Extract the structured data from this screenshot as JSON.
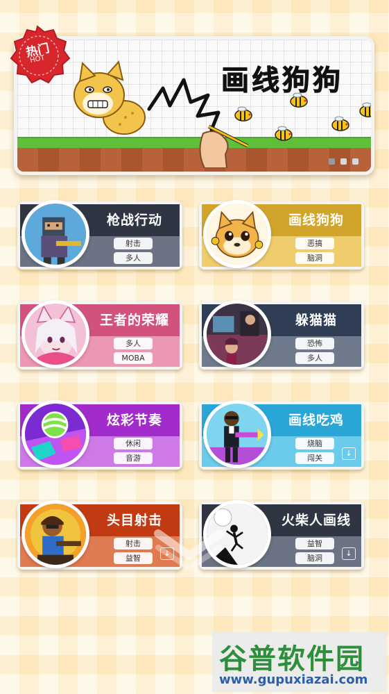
{
  "hot_badge": {
    "label": "热门",
    "sub": "HOT"
  },
  "banner": {
    "title": "画线狗狗",
    "page_count": 3,
    "active_page": 1
  },
  "games": [
    {
      "title": "枪战行动",
      "tags": [
        "射击",
        "多人"
      ],
      "avatar": "pixel-soldier",
      "download": false,
      "colors": {
        "top": "#2f3542",
        "bottom": "#6b7384"
      }
    },
    {
      "title": "画线狗狗",
      "tags": [
        "恶搞",
        "脑洞"
      ],
      "avatar": "shiba-dog",
      "download": false,
      "colors": {
        "top": "#d1a52c",
        "bottom": "#efcd6c"
      }
    },
    {
      "title": "王者的荣耀",
      "tags": [
        "多人",
        "MOBA"
      ],
      "avatar": "fox-girl-hero",
      "download": false,
      "colors": {
        "top": "#d2527e",
        "bottom": "#ec97b3"
      }
    },
    {
      "title": "躲猫猫",
      "tags": [
        "恐怖",
        "多人"
      ],
      "avatar": "hide-seek-room",
      "download": false,
      "colors": {
        "top": "#2f3e55",
        "bottom": "#6f7b8c"
      }
    },
    {
      "title": "炫彩节奏",
      "tags": [
        "休闲",
        "音游"
      ],
      "avatar": "rhythm-ball",
      "download": false,
      "colors": {
        "top": "#a12ccb",
        "bottom": "#cf79e8"
      }
    },
    {
      "title": "画线吃鸡",
      "tags": [
        "烧脑",
        "闯关"
      ],
      "avatar": "agent-gunner",
      "download": true,
      "colors": {
        "top": "#2aa6d6",
        "bottom": "#6bcbea"
      }
    },
    {
      "title": "头目射击",
      "tags": [
        "射击",
        "益智"
      ],
      "avatar": "boss-shooter",
      "download": true,
      "colors": {
        "top": "#c23a12",
        "bottom": "#e07a50"
      }
    },
    {
      "title": "火柴人画线",
      "tags": [
        "益智",
        "脑洞"
      ],
      "avatar": "stickman-fall",
      "download": true,
      "colors": {
        "top": "#2f3542",
        "bottom": "#6b7384"
      }
    }
  ],
  "watermark": {
    "logo": "谷普软件园",
    "url": "www.gupuxiazai.com"
  }
}
